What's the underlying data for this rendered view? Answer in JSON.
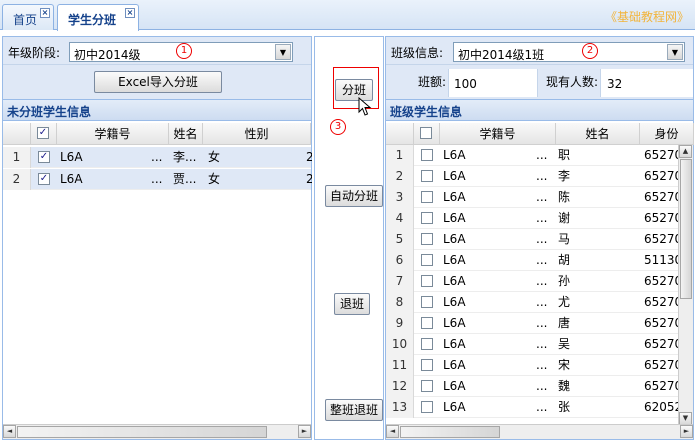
{
  "tabs": [
    {
      "label": "首页",
      "close": "×"
    },
    {
      "label": "学生分班",
      "close": "×"
    }
  ],
  "brand": "《基础教程网》",
  "left": {
    "grade_label": "年级阶段:",
    "grade_value": "初中2014级",
    "marker1": "1",
    "import_button": "Excel导入分班",
    "section_title": "未分班学生信息",
    "columns": [
      "学籍号",
      "姓名",
      "性别"
    ],
    "rows": [
      {
        "num": "1",
        "checked": "✓",
        "id": "L6A",
        "dots": "...",
        "name": "李...",
        "gender": "女",
        "extra": "2"
      },
      {
        "num": "2",
        "checked": "✓",
        "id": "L6A",
        "dots": "...",
        "name": "贾...",
        "gender": "女",
        "extra": "2"
      }
    ]
  },
  "middle": {
    "assign_button": "分班",
    "marker3": "3",
    "auto_button": "自动分班",
    "withdraw_button": "退班",
    "withdraw_all_button": "整班退班"
  },
  "right": {
    "class_label": "班级信息:",
    "class_value": "初中2014级1班",
    "marker2": "2",
    "quota_label": "班额:",
    "quota_value": "100",
    "count_label": "现有人数:",
    "count_value": "32",
    "section_title": "班级学生信息",
    "columns": [
      "学籍号",
      "姓名",
      "身份"
    ],
    "rows": [
      {
        "num": "1",
        "id": "L6A",
        "dots": "...",
        "name": "职",
        "idno": "65270"
      },
      {
        "num": "2",
        "id": "L6A",
        "dots": "...",
        "name": "李",
        "idno": "65270"
      },
      {
        "num": "3",
        "id": "L6A",
        "dots": "...",
        "name": "陈",
        "idno": "65270"
      },
      {
        "num": "4",
        "id": "L6A",
        "dots": "...",
        "name": "谢",
        "idno": "65270"
      },
      {
        "num": "5",
        "id": "L6A",
        "dots": "...",
        "name": "马",
        "idno": "65270"
      },
      {
        "num": "6",
        "id": "L6A",
        "dots": "...",
        "name": "胡",
        "idno": "51130"
      },
      {
        "num": "7",
        "id": "L6A",
        "dots": "...",
        "name": "孙",
        "idno": "65270"
      },
      {
        "num": "8",
        "id": "L6A",
        "dots": "...",
        "name": "尤",
        "idno": "65270"
      },
      {
        "num": "9",
        "id": "L6A",
        "dots": "...",
        "name": "唐",
        "idno": "65270"
      },
      {
        "num": "10",
        "id": "L6A",
        "dots": "...",
        "name": "吴",
        "idno": "65270"
      },
      {
        "num": "11",
        "id": "L6A",
        "dots": "...",
        "name": "宋",
        "idno": "65270"
      },
      {
        "num": "12",
        "id": "L6A",
        "dots": "...",
        "name": "魏",
        "idno": "65270"
      },
      {
        "num": "13",
        "id": "L6A",
        "dots": "...",
        "name": "张",
        "idno": "62052"
      }
    ]
  },
  "scroll": {
    "up": "▲",
    "down": "▼",
    "left": "◄",
    "right": "►",
    "combo": "▼"
  }
}
